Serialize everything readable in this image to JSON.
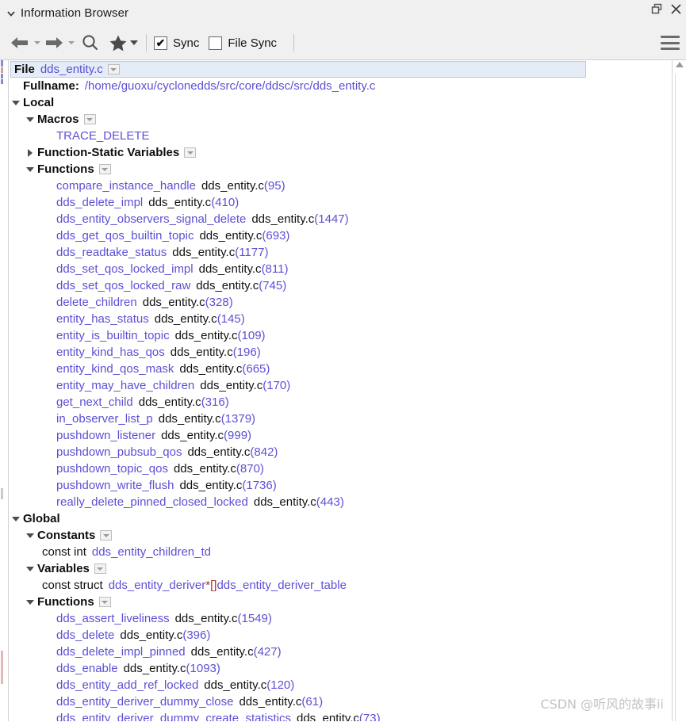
{
  "window": {
    "title": "Information Browser",
    "collapse_icon": "chevron-down-icon",
    "float_icon": "restore-window-icon",
    "close_icon": "close-icon"
  },
  "toolbar": {
    "back_icon": "arrow-left-icon",
    "forward_icon": "arrow-right-icon",
    "search_icon": "magnifier-icon",
    "favorites_icon": "star-icon",
    "menu_icon": "hamburger-menu-icon",
    "sync": {
      "label": "Sync",
      "checked": true,
      "tick": "✔"
    },
    "file_sync": {
      "label": "File Sync",
      "checked": false,
      "tick": ""
    }
  },
  "tree": {
    "file_row": {
      "kind_label": "File",
      "file_name": "dds_entity.c",
      "dropdown_icon": "chevron-down-icon"
    },
    "fullname": {
      "label": "Fullname:",
      "path": "/home/guoxu/cyclonedds/src/core/ddsc/src/dds_entity.c"
    },
    "local": {
      "label": "Local",
      "macros": {
        "label": "Macros",
        "items": [
          "TRACE_DELETE"
        ]
      },
      "function_static_variables": {
        "label": "Function-Static Variables"
      },
      "functions": {
        "label": "Functions",
        "items": [
          {
            "name": "compare_instance_handle",
            "file": "dds_entity.c",
            "line": "(95)"
          },
          {
            "name": "dds_delete_impl",
            "file": "dds_entity.c",
            "line": "(410)"
          },
          {
            "name": "dds_entity_observers_signal_delete",
            "file": "dds_entity.c",
            "line": "(1447)"
          },
          {
            "name": "dds_get_qos_builtin_topic",
            "file": "dds_entity.c",
            "line": "(693)"
          },
          {
            "name": "dds_readtake_status",
            "file": "dds_entity.c",
            "line": "(1177)"
          },
          {
            "name": "dds_set_qos_locked_impl",
            "file": "dds_entity.c",
            "line": "(811)"
          },
          {
            "name": "dds_set_qos_locked_raw",
            "file": "dds_entity.c",
            "line": "(745)"
          },
          {
            "name": "delete_children",
            "file": "dds_entity.c",
            "line": "(328)"
          },
          {
            "name": "entity_has_status",
            "file": "dds_entity.c",
            "line": "(145)"
          },
          {
            "name": "entity_is_builtin_topic",
            "file": "dds_entity.c",
            "line": "(109)"
          },
          {
            "name": "entity_kind_has_qos",
            "file": "dds_entity.c",
            "line": "(196)"
          },
          {
            "name": "entity_kind_qos_mask",
            "file": "dds_entity.c",
            "line": "(665)"
          },
          {
            "name": "entity_may_have_children",
            "file": "dds_entity.c",
            "line": "(170)"
          },
          {
            "name": "get_next_child",
            "file": "dds_entity.c",
            "line": "(316)"
          },
          {
            "name": "in_observer_list_p",
            "file": "dds_entity.c",
            "line": "(1379)"
          },
          {
            "name": "pushdown_listener",
            "file": "dds_entity.c",
            "line": "(999)"
          },
          {
            "name": "pushdown_pubsub_qos",
            "file": "dds_entity.c",
            "line": "(842)"
          },
          {
            "name": "pushdown_topic_qos",
            "file": "dds_entity.c",
            "line": "(870)"
          },
          {
            "name": "pushdown_write_flush",
            "file": "dds_entity.c",
            "line": "(1736)"
          },
          {
            "name": "really_delete_pinned_closed_locked",
            "file": "dds_entity.c",
            "line": "(443)"
          }
        ]
      }
    },
    "global": {
      "label": "Global",
      "constants": {
        "label": "Constants",
        "items": [
          {
            "type": "const int",
            "name": "dds_entity_children_td"
          }
        ]
      },
      "variables": {
        "label": "Variables",
        "items": [
          {
            "type": "const struct",
            "name": "dds_entity_deriver",
            "suffix": " *[]",
            "name2": "dds_entity_deriver_table"
          }
        ]
      },
      "functions": {
        "label": "Functions",
        "items": [
          {
            "name": "dds_assert_liveliness",
            "file": "dds_entity.c",
            "line": "(1549)"
          },
          {
            "name": "dds_delete",
            "file": "dds_entity.c",
            "line": "(396)"
          },
          {
            "name": "dds_delete_impl_pinned",
            "file": "dds_entity.c",
            "line": "(427)"
          },
          {
            "name": "dds_enable",
            "file": "dds_entity.c",
            "line": "(1093)"
          },
          {
            "name": "dds_entity_add_ref_locked",
            "file": "dds_entity.c",
            "line": "(120)"
          },
          {
            "name": "dds_entity_deriver_dummy_close",
            "file": "dds_entity.c",
            "line": "(61)"
          },
          {
            "name": "dds_entity_deriver_dummy_create_statistics",
            "file": "dds_entity.c",
            "line": "(73)"
          }
        ]
      }
    }
  },
  "watermark": {
    "text": "CSDN @听风的故事ii"
  }
}
